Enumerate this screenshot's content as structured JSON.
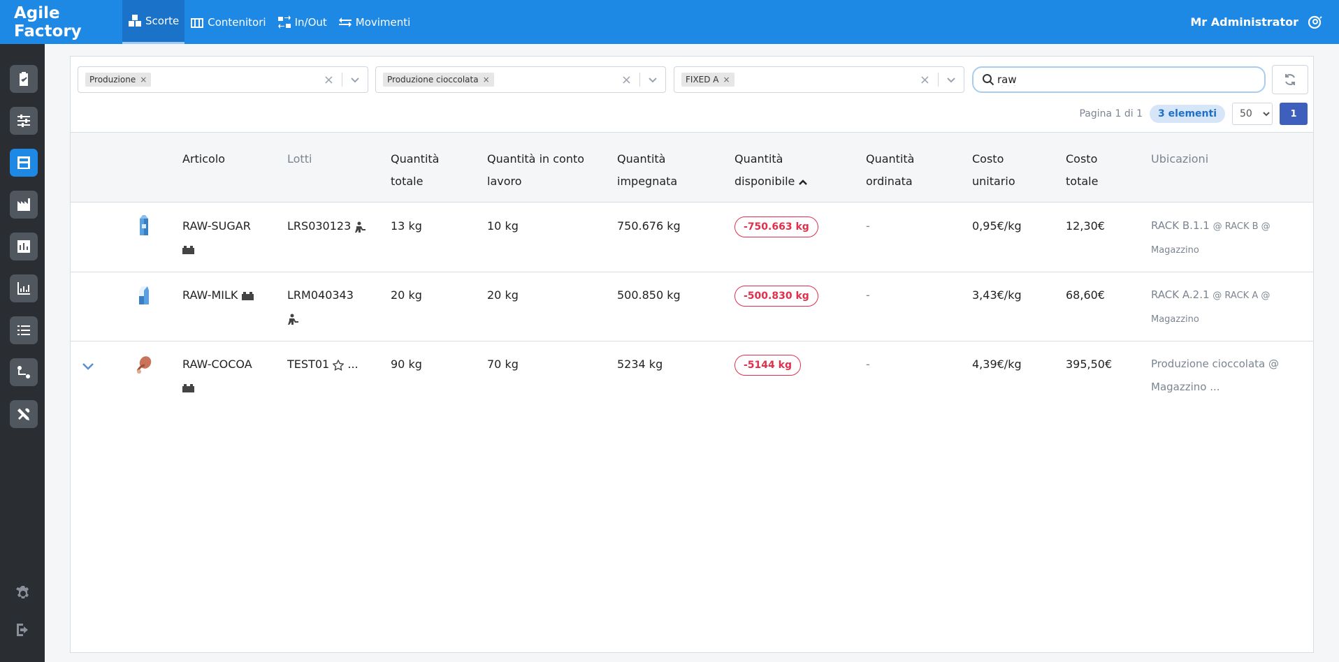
{
  "header": {
    "brand": "Agile Factory",
    "nav": [
      {
        "label": "Scorte",
        "icon": "boxes-icon"
      },
      {
        "label": "Contenitori",
        "icon": "containers-icon"
      },
      {
        "label": "In/Out",
        "icon": "in-out-icon"
      },
      {
        "label": "Movimenti",
        "icon": "arrows-icon"
      }
    ],
    "user": "Mr Administrator"
  },
  "sidebar": {
    "items": [
      "clipboard-check-icon",
      "sliders-icon",
      "warehouse-icon",
      "factory-icon",
      "bar-chart-icon",
      "line-chart-icon",
      "list-icon",
      "flow-icon",
      "tools-icon",
      "gear-icon",
      "logout-icon"
    ],
    "active": "warehouse-icon"
  },
  "filters": [
    {
      "chip": "Produzione"
    },
    {
      "chip": "Produzione cioccolata"
    },
    {
      "chip": "FIXED A"
    }
  ],
  "search": {
    "value": "raw"
  },
  "pager": {
    "page_info": "Pagina 1 di 1",
    "count": "3 elementi",
    "per_page": "50",
    "current_page": "1"
  },
  "table": {
    "headers": {
      "articolo": "Articolo",
      "lotti": "Lotti",
      "qtot": [
        "Quantità",
        "totale"
      ],
      "qconto": [
        "Quantità in conto",
        "lavoro"
      ],
      "qimp": [
        "Quantità",
        "impegnata"
      ],
      "qdisp": [
        "Quantità",
        "disponibile"
      ],
      "qord": [
        "Quantità",
        "ordinata"
      ],
      "cunit": [
        "Costo",
        "unitario"
      ],
      "ctot": [
        "Costo",
        "totale"
      ],
      "ubic": "Ubicazioni"
    },
    "rows": [
      {
        "article": "RAW-SUGAR",
        "lot": "LRS030123",
        "qty_total": "13 kg",
        "qty_conto": "10 kg",
        "qty_imp": "750.676 kg",
        "qty_disp": "-750.663 kg",
        "qty_ord": "-",
        "unit_cost": "0,95€/kg",
        "total_cost": "12,30€",
        "loc_main": "RACK B.1.1",
        "loc_small": "@ RACK B @",
        "loc_line2": "Magazzino"
      },
      {
        "article": "RAW-MILK",
        "lot": "LRM040343",
        "qty_total": "20 kg",
        "qty_conto": "20 kg",
        "qty_imp": "500.850 kg",
        "qty_disp": "-500.830 kg",
        "qty_ord": "-",
        "unit_cost": "3,43€/kg",
        "total_cost": "68,60€",
        "loc_main": "RACK A.2.1",
        "loc_small": "@ RACK A @",
        "loc_line2": "Magazzino"
      },
      {
        "article": "RAW-COCOA",
        "lot": "TEST01",
        "lot_more": "...",
        "qty_total": "90 kg",
        "qty_conto": "70 kg",
        "qty_imp": "5234 kg",
        "qty_disp": "-5144 kg",
        "qty_ord": "-",
        "unit_cost": "4,39€/kg",
        "total_cost": "395,50€",
        "loc_main": "Produzione cioccolata @",
        "loc_line2": "Magazzino ..."
      }
    ]
  }
}
